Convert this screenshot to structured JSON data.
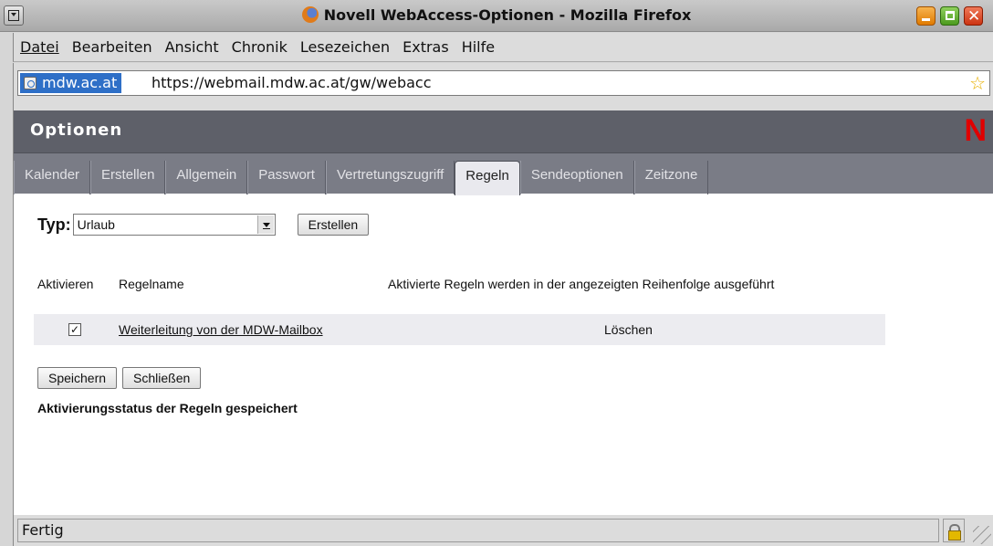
{
  "window": {
    "title": "Novell WebAccess-Optionen - Mozilla Firefox"
  },
  "menubar": {
    "items": [
      {
        "label": "Datei"
      },
      {
        "label": "Bearbeiten"
      },
      {
        "label": "Ansicht"
      },
      {
        "label": "Chronik"
      },
      {
        "label": "Lesezeichen"
      },
      {
        "label": "Extras"
      },
      {
        "label": "Hilfe"
      }
    ]
  },
  "urlbar": {
    "site_identity": "mdw.ac.at",
    "url": "https://webmail.mdw.ac.at/gw/webacc"
  },
  "page": {
    "header_title": "Optionen",
    "logo_letter": "N",
    "tabs": [
      {
        "label": "Kalender"
      },
      {
        "label": "Erstellen"
      },
      {
        "label": "Allgemein"
      },
      {
        "label": "Passwort"
      },
      {
        "label": "Vertretungszugriff"
      },
      {
        "label": "Regeln",
        "active": true
      },
      {
        "label": "Sendeoptionen"
      },
      {
        "label": "Zeitzone"
      }
    ],
    "type_label": "Typ:",
    "type_select_value": "Urlaub",
    "create_button": "Erstellen",
    "columns": {
      "activate": "Aktivieren",
      "rule_name": "Regelname",
      "note": "Aktivierte Regeln werden in der angezeigten Reihenfolge ausgeführt"
    },
    "rules": [
      {
        "checked": true,
        "check_mark": "✓",
        "name": "Weiterleitung von der MDW-Mailbox",
        "delete_label": "Löschen"
      }
    ],
    "save_button": "Speichern",
    "close_button": "Schließen",
    "status_message": "Aktivierungsstatus der Regeln gespeichert"
  },
  "statusbar": {
    "text": "Fertig"
  },
  "colors": {
    "header_bg": "#5e6069",
    "tabbar_bg": "#7a7c86",
    "site_identity_bg": "#2e6fc7",
    "logo_red": "#e00000"
  }
}
